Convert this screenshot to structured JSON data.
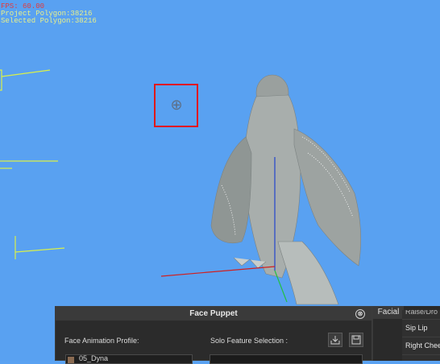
{
  "stats": {
    "fps": "FPS: 60.00",
    "project_polygon": "Project Polygon:38216",
    "selected_polygon": "Selected Polygon:38216"
  },
  "viewport": {
    "crosshair_icon": "target-crosshair"
  },
  "face_puppet": {
    "title": "Face Puppet",
    "close_icon": "⊗",
    "profile_label": "Face Animation Profile:",
    "profile_value": "05_Dyna",
    "solo_label": "Solo Feature Selection :",
    "import_icon": "import-icon",
    "save_icon": "save-icon"
  },
  "facial": {
    "tab_label": "Facial",
    "items": [
      "Raise/Dro",
      "Sip Lip",
      "Right Chee"
    ]
  },
  "colors": {
    "background": "#59a1f1",
    "fps": "#e53a3a",
    "polygon_text": "#e8f08a",
    "highlight_box": "#e01818"
  }
}
